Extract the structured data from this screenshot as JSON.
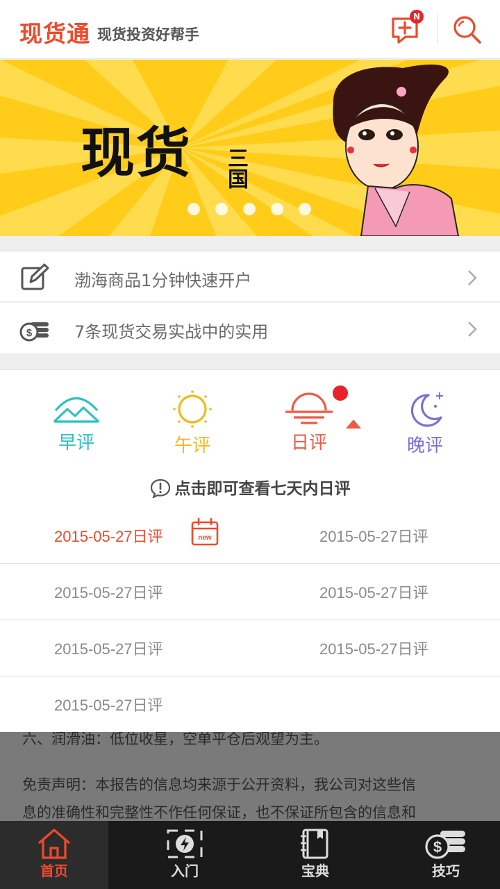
{
  "header": {
    "brand": "现货通",
    "slogan": "现货投资好帮手",
    "badge": "N",
    "icons": [
      "message-add-icon",
      "search-icon"
    ]
  },
  "banner": {
    "title": "现货",
    "subtitle": "三国",
    "dot_count": 5,
    "active_dot": 0
  },
  "promos": [
    {
      "label": "渤海商品1分钟快速开户",
      "icon": "edit-icon"
    },
    {
      "label": "7条现货交易实战中的实用",
      "icon": "coins-icon"
    }
  ],
  "review_tabs": [
    {
      "label": "早评",
      "color": "#2bc2c2",
      "icon": "mountain-sunrise-icon"
    },
    {
      "label": "午评",
      "color": "#f5b81c",
      "icon": "sun-icon"
    },
    {
      "label": "日评",
      "color": "#ee5a43",
      "icon": "sunset-icon",
      "selected": true
    },
    {
      "label": "晚评",
      "color": "#7b6fd6",
      "icon": "moon-icon"
    }
  ],
  "hint": "点击即可查看七天内日评",
  "dates": [
    [
      "2015-05-27日评",
      "2015-05-27日评"
    ],
    [
      "2015-05-27日评",
      "2015-05-27日评"
    ],
    [
      "2015-05-27日评",
      "2015-05-27日评"
    ],
    [
      "2015-05-27日评"
    ]
  ],
  "new_label": "new",
  "article": {
    "line1": "六、润滑油：低位收星，空单平仓后观望为主。",
    "line2": "免责声明：本报告的信息均来源于公开资料，我公司对这些信",
    "line3": "息的准确性和完整性不作任何保证，也不保证所包含的信息和"
  },
  "nav": [
    {
      "label": "首页",
      "icon": "home-icon",
      "active": true
    },
    {
      "label": "入门",
      "icon": "lightning-icon"
    },
    {
      "label": "宝典",
      "icon": "book-icon"
    },
    {
      "label": "技巧",
      "icon": "coins-icon"
    }
  ],
  "colors": {
    "accent": "#ee4a2b",
    "banner": "#ffcc1a"
  }
}
